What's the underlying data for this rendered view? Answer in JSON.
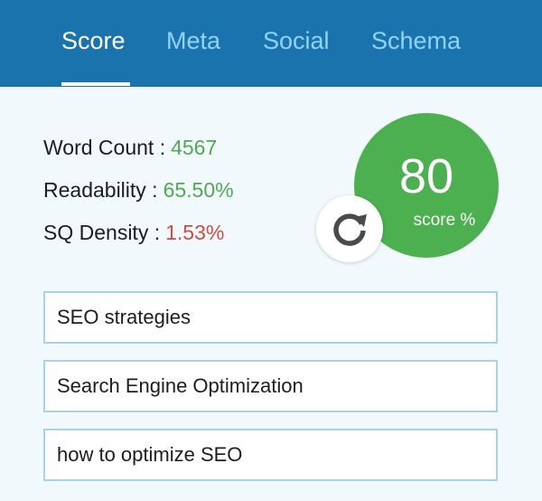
{
  "tabs": [
    {
      "label": "Score",
      "active": true
    },
    {
      "label": "Meta",
      "active": false
    },
    {
      "label": "Social",
      "active": false
    },
    {
      "label": "Schema",
      "active": false
    }
  ],
  "stats": {
    "word_count": {
      "label": "Word Count :",
      "value": "4567"
    },
    "readability": {
      "label": "Readability :",
      "value": "65.50%"
    },
    "sq_density": {
      "label": "SQ Density :",
      "value": "1.53%"
    }
  },
  "score": {
    "value": "80",
    "unit": "score %"
  },
  "keywords": [
    "SEO strategies",
    "Search Engine Optimization",
    "how to optimize SEO"
  ],
  "colors": {
    "header": "#1a73ad",
    "tab_inactive": "#8fd3ff",
    "score_green": "#4caf50",
    "value_green": "#52a852",
    "value_red": "#d64a3c",
    "background": "#f1f9fd",
    "input_border": "#a8d2ea"
  },
  "icons": {
    "refresh": "refresh-icon"
  }
}
